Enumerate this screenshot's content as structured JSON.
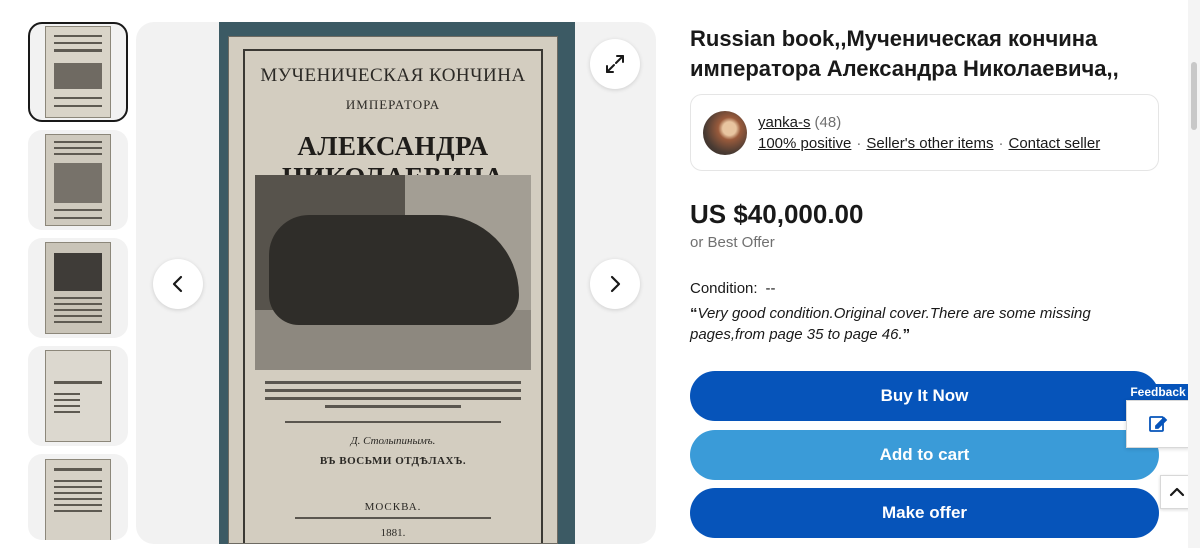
{
  "gallery": {
    "thumbnails": [
      {
        "active": true
      },
      {
        "active": false
      },
      {
        "active": false
      },
      {
        "active": false
      },
      {
        "active": false
      }
    ],
    "book_cover": {
      "line1": "МУЧЕНИЧЕСКАЯ КОНЧИНА",
      "line2": "ИМПЕРАТОРА",
      "line3": "АЛЕКСАНДРА НИКОЛАЕВИЧА",
      "line4": "Д. Столыпинымъ.",
      "line5": "ВЪ ВОСЬМИ ОТДѢЛАХЪ.",
      "line6": "МОСКВА.",
      "line7": "1881."
    },
    "icons": {
      "expand": "expand-icon",
      "prev": "chevron-left-icon",
      "next": "chevron-right-icon"
    }
  },
  "listing": {
    "title": "Russian book,,Мученическая кончина императора Александра Николаевича,,",
    "seller": {
      "name": "yanka-s",
      "feedback_count": "(48)",
      "positive": "100% positive",
      "other_items": "Seller's other items",
      "contact": "Contact seller"
    },
    "price": "US $40,000.00",
    "best_offer": "or Best Offer",
    "condition_label": "Condition:",
    "condition_value": "--",
    "condition_note": "Very good condition.Original cover.There are some missing pages,from page 35 to page 46.",
    "buttons": {
      "buy": "Buy It Now",
      "cart": "Add to cart",
      "offer": "Make offer"
    }
  },
  "widgets": {
    "feedback_label": "Feedback"
  },
  "colors": {
    "primary_blue": "#0654ba",
    "cart_blue": "#3a9bd8"
  }
}
